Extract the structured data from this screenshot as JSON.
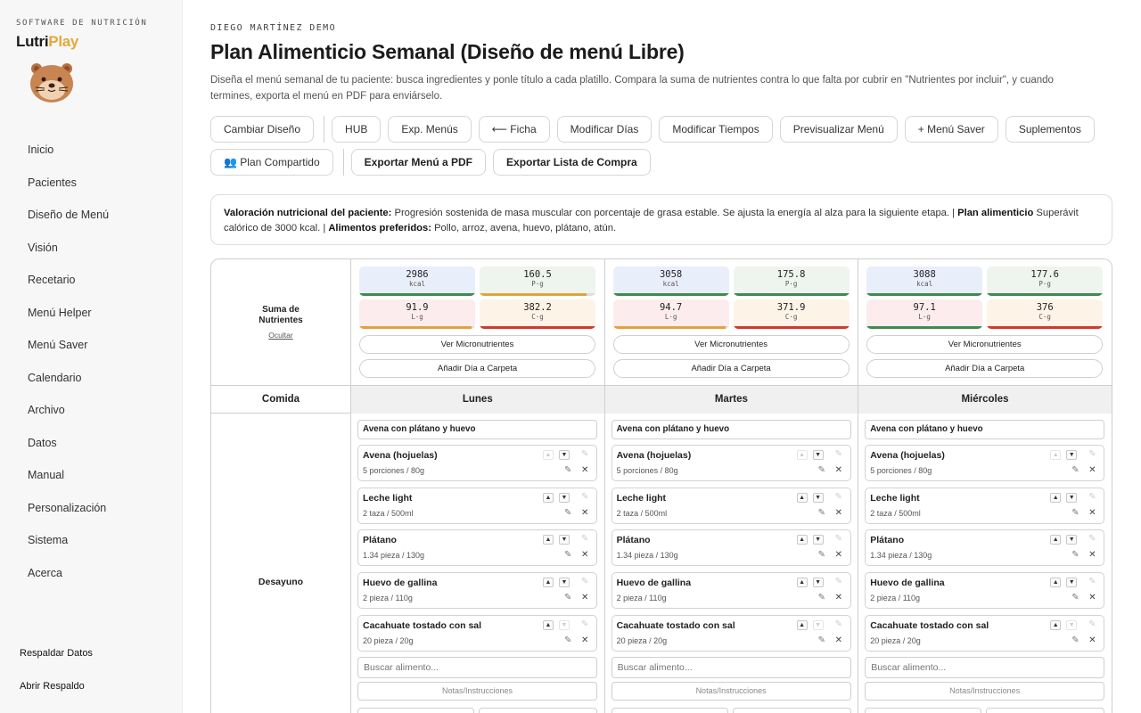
{
  "sidebar": {
    "brand_sup": "SOFTWARE DE NUTRICIÓN",
    "brand_a": "Lutri",
    "brand_b": "Play",
    "items": [
      "Inicio",
      "Pacientes",
      "Diseño de Menú",
      "Visión",
      "Recetario",
      "Menú Helper",
      "Menú Saver",
      "Calendario",
      "Archivo",
      "Datos",
      "Manual",
      "Personalización",
      "Sistema",
      "Acerca"
    ],
    "backup": "Respaldar Datos",
    "open_backup": "Abrir Respaldo"
  },
  "header": {
    "owner": "DIEGO MARTÍNEZ DEMO",
    "title": "Plan Alimenticio Semanal (Diseño de menú Libre)",
    "description": "Diseña el menú semanal de tu paciente: busca ingredientes y ponle título a cada platillo. Compara la suma de nutrientes contra lo que falta por cubrir en \"Nutrientes por incluir\", y cuando termines, exporta el menú en PDF para enviárselo."
  },
  "toolbar": {
    "change_design": "Cambiar Diseño",
    "hub": "HUB",
    "exp_menus": "Exp. Menús",
    "ficha": "⟵ Ficha",
    "mod_days": "Modificar Días",
    "mod_times": "Modificar Tiempos",
    "preview": "Previsualizar Menú",
    "menu_saver": "+ Menú Saver",
    "supplements": "Suplementos",
    "shared_plan": "👥 Plan Compartido",
    "export_pdf": "Exportar Menú a PDF",
    "export_list": "Exportar Lista de Compra"
  },
  "info": {
    "label1": "Valoración nutricional del paciente:",
    "text1": " Progresión sostenida de masa muscular con porcentaje de grasa estable. Se ajusta la energía al alza para la siguiente etapa. | ",
    "label2": "Plan alimenticio",
    "text2": " Superávit calórico de 3000 kcal. | ",
    "label3": "Alimentos preferidos:",
    "text3": " Pollo, arroz, avena, huevo, plátano, atún."
  },
  "grid": {
    "sum_label": "Suma de Nutrientes",
    "hide": "Ocultar",
    "comida": "Comida",
    "meal": "Desayuno",
    "micro_btn": "Ver Micronutrientes",
    "folder_btn": "Añadir Día a Carpeta",
    "search_placeholder": "Buscar alimento...",
    "notes": "Notas/Instrucciones",
    "units": {
      "kcal": "kcal",
      "p": "P·g",
      "l": "L·g",
      "c": "C·g"
    },
    "colors": {
      "kcal_bg": "#e9eefb",
      "p_bg": "#edf5ee",
      "l_bg": "#fcecee",
      "c_bg": "#fdf3e6",
      "green": "#3f8a4f",
      "orange": "#e2a23b",
      "red": "#d0392f"
    },
    "days": [
      {
        "name": "Lunes",
        "kcal": "2986",
        "p": "160.5",
        "l": "91.9",
        "c": "382.2",
        "kcal_fill": 1.0,
        "p_fill": 0.92,
        "l_fill": 0.97,
        "c_fill": 1.0,
        "p_color": "orange",
        "l_color": "orange",
        "c_color": "red",
        "meal_title": "Avena con plátano y huevo"
      },
      {
        "name": "Martes",
        "kcal": "3058",
        "p": "175.8",
        "l": "94.7",
        "c": "371.9",
        "kcal_fill": 1.0,
        "p_fill": 1.0,
        "l_fill": 0.97,
        "c_fill": 1.0,
        "p_color": "green",
        "l_color": "orange",
        "c_color": "red",
        "meal_title": "Avena con plátano y huevo"
      },
      {
        "name": "Miércoles",
        "kcal": "3088",
        "p": "177.6",
        "l": "97.1",
        "c": "376",
        "kcal_fill": 1.0,
        "p_fill": 1.0,
        "l_fill": 1.0,
        "c_fill": 1.0,
        "p_color": "green",
        "l_color": "green",
        "c_color": "red",
        "meal_title": "Avena con plátano y huevo"
      }
    ],
    "foods": [
      {
        "name": "Avena (hojuelas)",
        "qty": "5 porciones / 80g"
      },
      {
        "name": "Leche light",
        "qty": "2 taza / 500ml"
      },
      {
        "name": "Plátano",
        "qty": "1.34 pieza / 130g"
      },
      {
        "name": "Huevo de gallina",
        "qty": "2 pieza / 110g"
      },
      {
        "name": "Cacahuate tostado con sal",
        "qty": "20 pieza / 20g"
      }
    ],
    "icons": {
      "up": "▲",
      "down": "▼",
      "edit": "✎",
      "remove": "✕"
    }
  }
}
